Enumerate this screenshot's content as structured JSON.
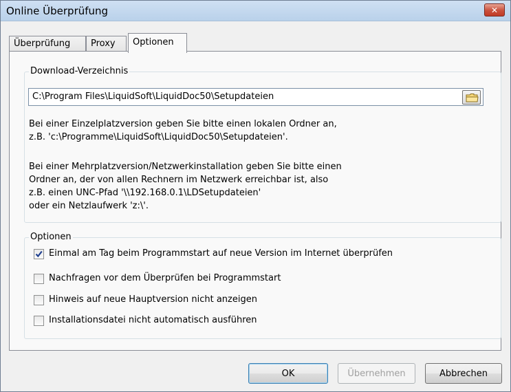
{
  "window": {
    "title": "Online Überprüfung",
    "close_label": "✕"
  },
  "tabs": [
    {
      "label": "Überprüfung",
      "active": false
    },
    {
      "label": "Proxy",
      "active": false
    },
    {
      "label": "Optionen",
      "active": true
    }
  ],
  "download": {
    "legend": "Download-Verzeichnis",
    "path_value": "C:\\Program Files\\LiquidSoft\\LiquidDoc50\\Setupdateien",
    "browse_icon": "folder-icon",
    "hint_lines": [
      "Bei einer Einzelplatzversion geben Sie bitte einen lokalen Ordner an,",
      "z.B. 'c:\\Programme\\LiquidSoft\\LiquidDoc50\\Setupdateien'.",
      "Bei einer Mehrplatzversion/Netzwerkinstallation geben Sie bitte einen",
      "Ordner an, der von allen Rechnern im Netzwerk erreichbar ist, also",
      "z.B. einen UNC-Pfad '\\\\192.168.0.1\\LDSetupdateien'",
      "oder ein Netzlaufwerk 'z:\\'."
    ]
  },
  "options": {
    "legend": "Optionen",
    "checkboxes": [
      {
        "label": "Einmal am Tag beim Programmstart auf neue Version im Internet überprüfen",
        "checked": true
      },
      {
        "label": "Nachfragen vor dem Überprüfen bei Programmstart",
        "checked": false
      },
      {
        "label": "Hinweis auf neue Hauptversion nicht anzeigen",
        "checked": false
      },
      {
        "label": "Installationsdatei nicht automatisch ausführen",
        "checked": false
      }
    ]
  },
  "buttons": {
    "ok": "OK",
    "apply": "Übernehmen",
    "cancel": "Abbrechen"
  },
  "colors": {
    "close_button": "#c9503c",
    "titlebar": "#b9d1ea",
    "check": "#1f3f8f"
  }
}
